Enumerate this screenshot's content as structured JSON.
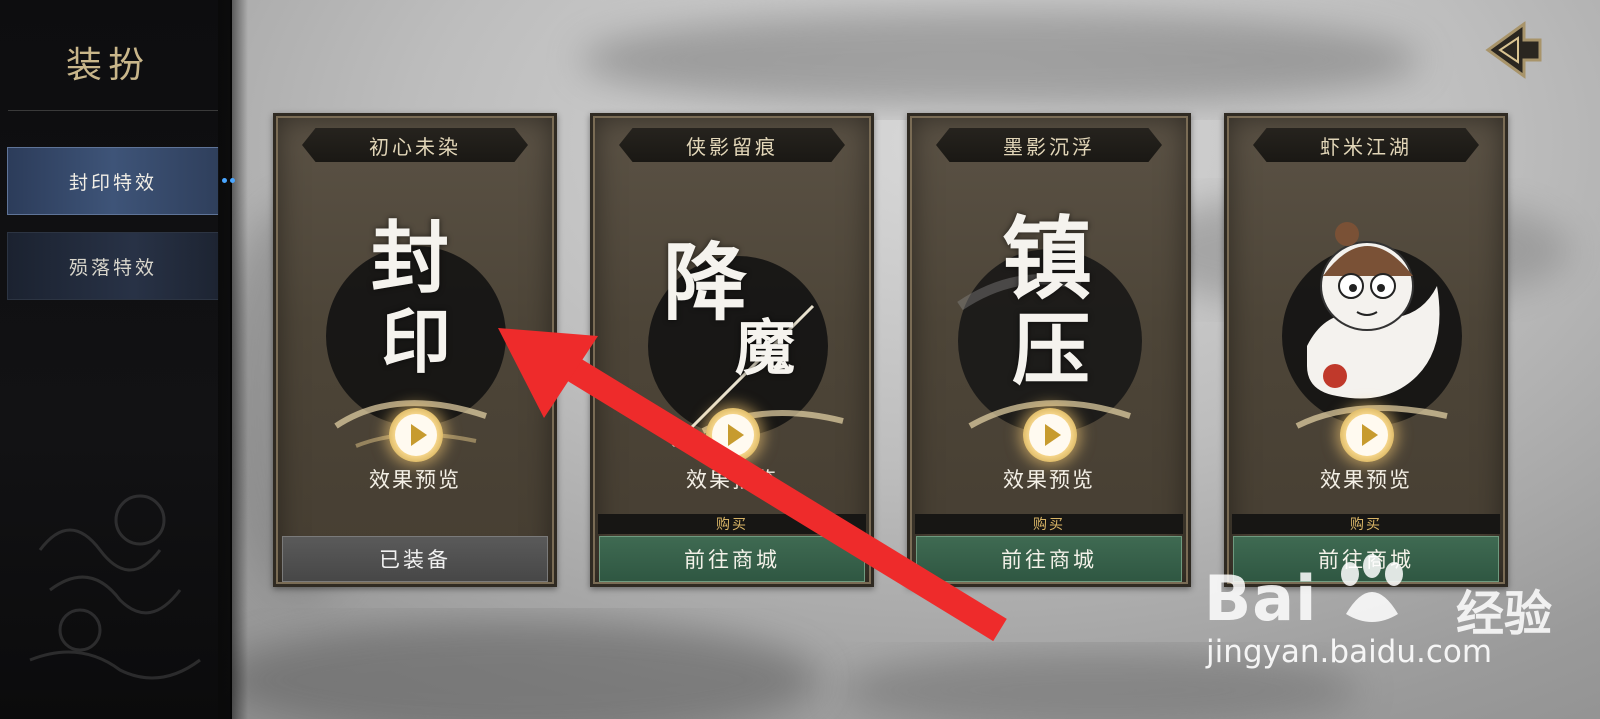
{
  "sidebar": {
    "title": "装扮",
    "items": [
      {
        "label": "封印特效",
        "active": true
      },
      {
        "label": "殒落特效",
        "active": false
      }
    ]
  },
  "cards": [
    {
      "title": "初心未染",
      "art_text_1": "封",
      "art_text_2": "印",
      "preview_label": "效果预览",
      "button_label": "已装备",
      "state": "equipped"
    },
    {
      "title": "侠影留痕",
      "art_text_1": "降",
      "art_text_2": "魔",
      "preview_label": "效果预览",
      "buy_label": "购买",
      "button_label": "前往商城",
      "state": "store"
    },
    {
      "title": "墨影沉浮",
      "art_text_1": "镇",
      "art_text_2": "压",
      "preview_label": "效果预览",
      "buy_label": "购买",
      "button_label": "前往商城",
      "state": "store"
    },
    {
      "title": "虾米江湖",
      "preview_label": "效果预览",
      "buy_label": "购买",
      "button_label": "前往商城",
      "state": "store"
    }
  ],
  "watermark": {
    "brand": "Bai",
    "brand_cn": "经验",
    "url": "jingyan.baidu.com"
  },
  "colors": {
    "accent_gold": "#c9b68a",
    "active_tab": "#3e5478",
    "store_button": "#2f5742",
    "arrow": "#ee2b2b"
  }
}
